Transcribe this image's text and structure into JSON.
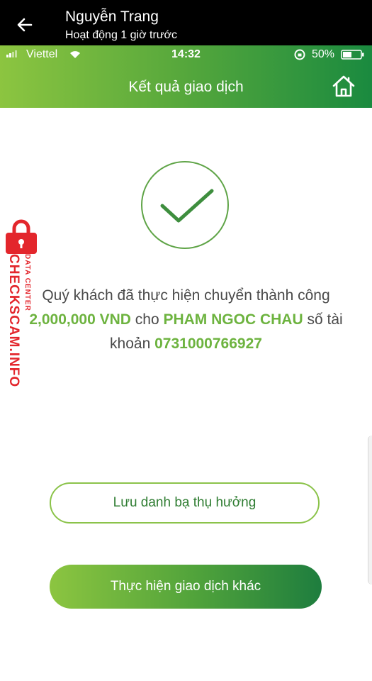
{
  "messenger": {
    "contact_name": "Nguyễn Trang",
    "status": "Hoạt động 1 giờ trước",
    "back_icon": "arrow-left-icon"
  },
  "status_bar": {
    "carrier": "Viettel",
    "time": "14:32",
    "battery": "50%"
  },
  "app": {
    "title": "Kết quả giao dịch",
    "home_icon": "home-icon",
    "success_icon": "check-circle-icon",
    "accent_color": "#6db33f"
  },
  "message": {
    "part1": "Quý khách đã thực hiện chuyển thành công ",
    "amount": "2,000,000 VND",
    "part2": " cho ",
    "recipient": "PHAM NGOC CHAU",
    "part3": " số tài khoản ",
    "account": "0731000766927"
  },
  "buttons": {
    "save_beneficiary": "Lưu danh bạ thụ hưởng",
    "new_transaction": "Thực hiện giao dịch khác"
  },
  "watermark": {
    "main": "CHECKSCAM.INFO",
    "sub": "DATA CENTER",
    "color": "#e3262c"
  }
}
